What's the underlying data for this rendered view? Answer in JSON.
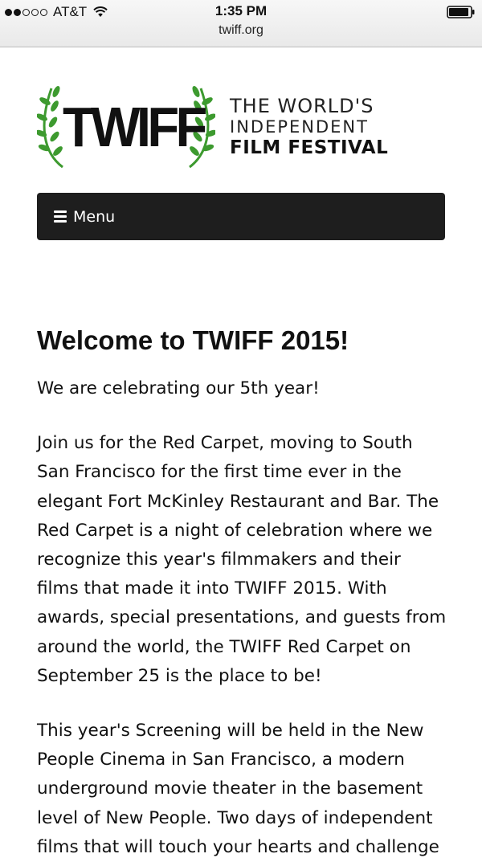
{
  "status_bar": {
    "carrier": "AT&T",
    "signal_bars_filled": 2,
    "signal_bars_total": 5,
    "time": "1:35 PM",
    "url": "twiff.org",
    "battery_icon": "battery-icon",
    "wifi_icon": "wifi-icon"
  },
  "logo": {
    "wordmark": "TWIFF",
    "tagline_line1": "THE WORLD'S",
    "tagline_line2": "INDEPENDENT",
    "tagline_line3": "FILM FESTIVAL",
    "laurel_color": "#3d9a2f"
  },
  "menu": {
    "label": "Menu",
    "icon": "hamburger-icon"
  },
  "article": {
    "title": "Welcome to TWIFF 2015!",
    "intro": "We are celebrating our 5th year!",
    "paragraph_red_carpet": "Join us for the Red Carpet, moving to South San Francisco for the first time ever in the elegant Fort McKinley Restaurant and Bar. The Red Carpet is a night of celebration where we recognize this year's filmmakers and their films that made it into TWIFF 2015. With awards, special presentations, and guests from around the world, the TWIFF Red Carpet on September 25 is the place to be!",
    "paragraph_screening": "This year's Screening will be held in the New People Cinema in San Francisco, a modern underground movie theater in the basement level of New People. Two days of independent films that will touch your hearts and challenge"
  },
  "colors": {
    "menu_background": "#1e1e1e",
    "menu_text": "#ffffff",
    "body_text": "#111111",
    "page_background": "#ffffff"
  }
}
